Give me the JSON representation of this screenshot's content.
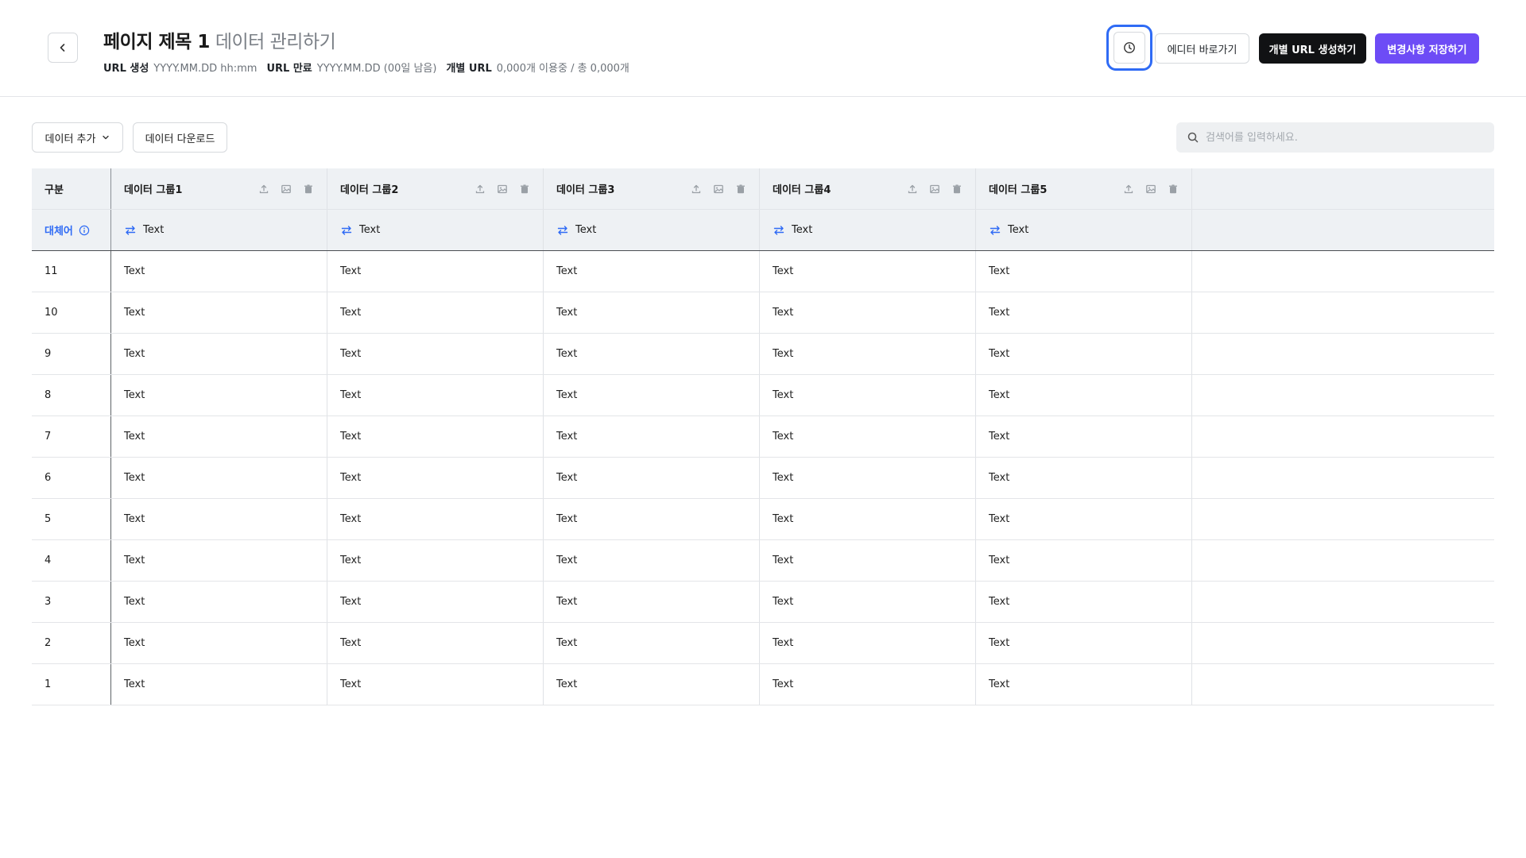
{
  "header": {
    "title_main": "페이지 제목 1",
    "title_sub": "데이터 관리하기",
    "meta": [
      {
        "key": "URL 생성",
        "value": "YYYY.MM.DD hh:mm"
      },
      {
        "key": "URL 만료",
        "value": "YYYY.MM.DD (00일 남음)"
      },
      {
        "key": "개별 URL",
        "value": "0,000개 이용중 / 총 0,000개"
      }
    ],
    "editor_label": "에디터 바로가기",
    "url_label": "개별 URL 생성하기",
    "save_label": "변경사항 저장하기"
  },
  "toolbar": {
    "add_label": "데이터 추가",
    "download_label": "데이터 다운로드",
    "search_placeholder": "검색어를 입력하세요."
  },
  "table": {
    "first_col_header": "구분",
    "alt_label": "대체어",
    "groups": [
      "데이터 그룹1",
      "데이터 그룹2",
      "데이터 그룹3",
      "데이터 그룹4",
      "데이터 그룹5"
    ],
    "alt_values": [
      "Text",
      "Text",
      "Text",
      "Text",
      "Text"
    ],
    "rows": [
      {
        "id": "11",
        "cells": [
          "Text",
          "Text",
          "Text",
          "Text",
          "Text"
        ]
      },
      {
        "id": "10",
        "cells": [
          "Text",
          "Text",
          "Text",
          "Text",
          "Text"
        ]
      },
      {
        "id": "9",
        "cells": [
          "Text",
          "Text",
          "Text",
          "Text",
          "Text"
        ]
      },
      {
        "id": "8",
        "cells": [
          "Text",
          "Text",
          "Text",
          "Text",
          "Text"
        ]
      },
      {
        "id": "7",
        "cells": [
          "Text",
          "Text",
          "Text",
          "Text",
          "Text"
        ]
      },
      {
        "id": "6",
        "cells": [
          "Text",
          "Text",
          "Text",
          "Text",
          "Text"
        ]
      },
      {
        "id": "5",
        "cells": [
          "Text",
          "Text",
          "Text",
          "Text",
          "Text"
        ]
      },
      {
        "id": "4",
        "cells": [
          "Text",
          "Text",
          "Text",
          "Text",
          "Text"
        ]
      },
      {
        "id": "3",
        "cells": [
          "Text",
          "Text",
          "Text",
          "Text",
          "Text"
        ]
      },
      {
        "id": "2",
        "cells": [
          "Text",
          "Text",
          "Text",
          "Text",
          "Text"
        ]
      },
      {
        "id": "1",
        "cells": [
          "Text",
          "Text",
          "Text",
          "Text",
          "Text"
        ]
      }
    ]
  },
  "colors": {
    "accent_purple": "#6d4cf6",
    "focus_blue": "#2f6bf5",
    "dark_button": "#111214",
    "header_bg": "#eef1f4"
  },
  "icons": {
    "back": "chevron-left-icon",
    "history": "clock-icon",
    "dropdown": "chevron-down-icon",
    "search": "search-icon",
    "upload": "upload-icon",
    "image": "image-icon",
    "delete": "trash-icon",
    "swap": "swap-icon",
    "info": "info-icon"
  }
}
